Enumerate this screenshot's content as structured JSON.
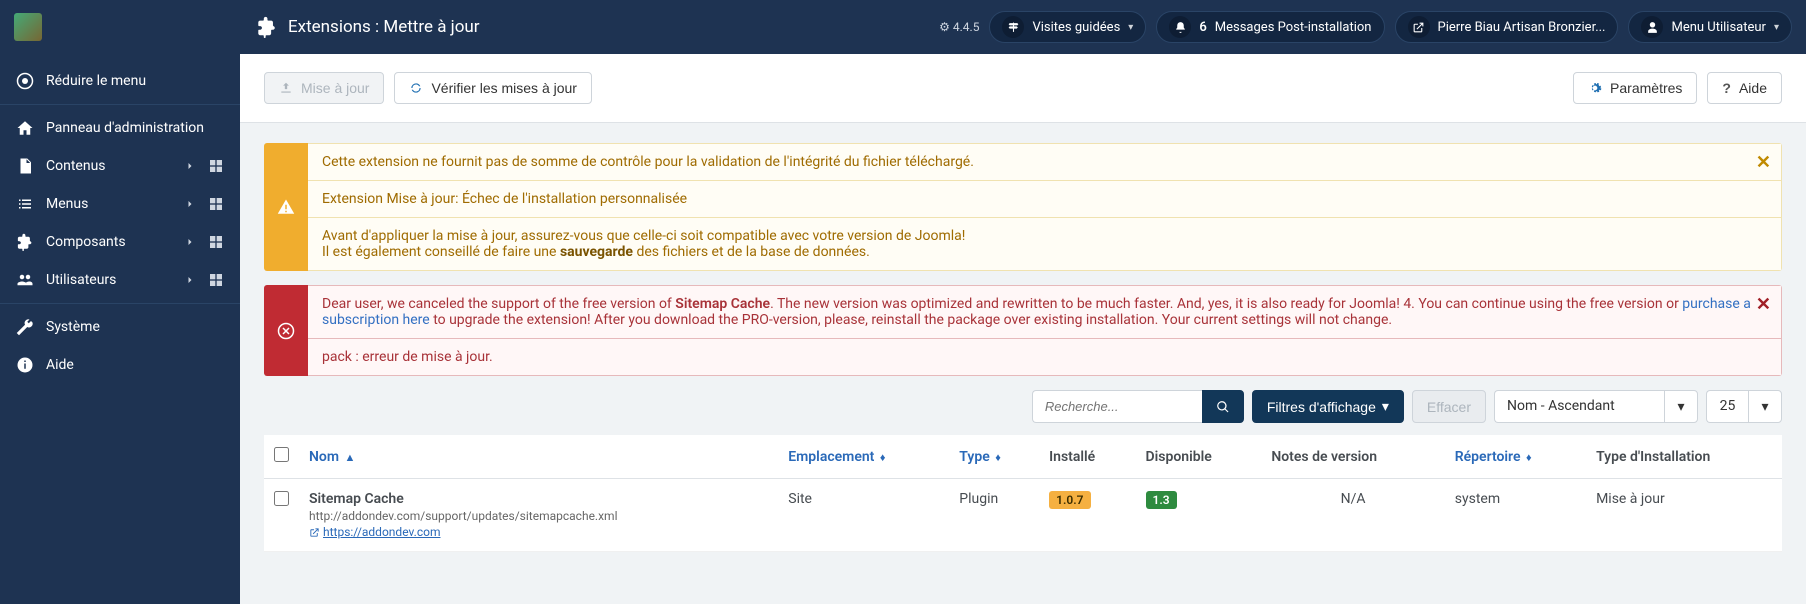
{
  "header": {
    "page_title": "Extensions : Mettre à jour",
    "version": "4.4.5",
    "tours_label": "Visites guidées",
    "notif_count": "6",
    "post_install_label": "Messages Post-installation",
    "site_label": "Pierre Biau Artisan Bronzier...",
    "user_label": "Menu Utilisateur"
  },
  "sidebar": {
    "toggle": "Réduire le menu",
    "items": [
      {
        "label": "Panneau d'administration"
      },
      {
        "label": "Contenus"
      },
      {
        "label": "Menus"
      },
      {
        "label": "Composants"
      },
      {
        "label": "Utilisateurs"
      },
      {
        "label": "Système"
      },
      {
        "label": "Aide"
      }
    ]
  },
  "toolbar": {
    "update_btn": "Mise à jour",
    "check_btn": "Vérifier les mises à jour",
    "options_btn": "Paramètres",
    "help_btn": "Aide"
  },
  "alerts": {
    "warn1": "Cette extension ne fournit pas de somme de contrôle pour la validation de l'intégrité du fichier téléchargé.",
    "warn2": "Extension Mise à jour: Échec de l'installation personnalisée",
    "warn3_a": "Avant d'appliquer la mise à jour, assurez-vous que celle-ci soit compatible avec votre version de Joomla!",
    "warn3_b1": "Il est également conseillé de faire une ",
    "warn3_bold": "sauvegarde",
    "warn3_b2": " des fichiers et de la base de données.",
    "err1_a": "Dear user, we canceled the support of the free version of ",
    "err1_bold": "Sitemap Cache",
    "err1_b": ". The new version was optimized and rewritten to be much faster. And, yes, it is also ready for Joomla! 4. You can continue using the free version or ",
    "err1_link": "purchase a subscription here",
    "err1_c": " to upgrade the extension! After you download the PRO-version, please, reinstall the package over existing installation. Your current settings will not change.",
    "err2": "pack : erreur de mise à jour."
  },
  "filters": {
    "search_placeholder": "Recherche...",
    "filter_btn": "Filtres d'affichage",
    "clear_btn": "Effacer",
    "sort": "Nom - Ascendant",
    "limit": "25"
  },
  "table": {
    "headers": {
      "name": "Nom",
      "location": "Emplacement",
      "type": "Type",
      "installed": "Installé",
      "available": "Disponible",
      "notes": "Notes de version",
      "folder": "Répertoire",
      "install_type": "Type d'Installation"
    },
    "rows": [
      {
        "name": "Sitemap Cache",
        "update_url": "http://addondev.com/support/updates/sitemapcache.xml",
        "homepage": "https://addondev.com",
        "location": "Site",
        "type": "Plugin",
        "installed": "1.0.7",
        "available": "1.3",
        "notes": "N/A",
        "folder": "system",
        "install_type": "Mise à jour"
      }
    ]
  }
}
